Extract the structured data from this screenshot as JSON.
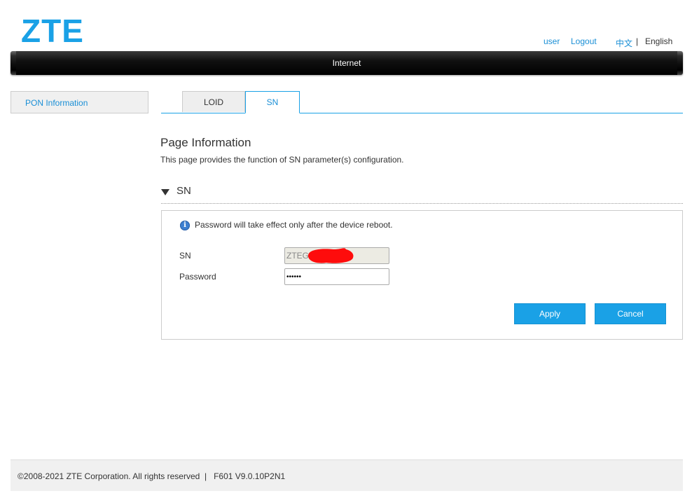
{
  "header": {
    "logo": "ZTE",
    "user_link": "user",
    "logout_link": "Logout",
    "lang_zh": "中文",
    "lang_sep": "|",
    "lang_en": "English"
  },
  "nav": {
    "current": "Internet"
  },
  "sidebar": {
    "items": [
      {
        "label": "PON Information"
      }
    ]
  },
  "tabs": [
    {
      "label": "LOID",
      "active": false
    },
    {
      "label": "SN",
      "active": true
    }
  ],
  "page": {
    "title": "Page Information",
    "description": "This page provides the function of SN parameter(s) configuration."
  },
  "section": {
    "title": "SN",
    "info_text": "Password will take effect only after the device reboot.",
    "fields": {
      "sn_label": "SN",
      "sn_value": "ZTEG",
      "password_label": "Password",
      "password_value": "••••••"
    },
    "buttons": {
      "apply": "Apply",
      "cancel": "Cancel"
    }
  },
  "footer": {
    "text": "©2008-2021 ZTE Corporation. All rights reserved  |   F601 V9.0.10P2N1"
  },
  "colors": {
    "accent": "#1aa1e6",
    "link": "#1a8fd6",
    "redaction": "#ff0000"
  }
}
